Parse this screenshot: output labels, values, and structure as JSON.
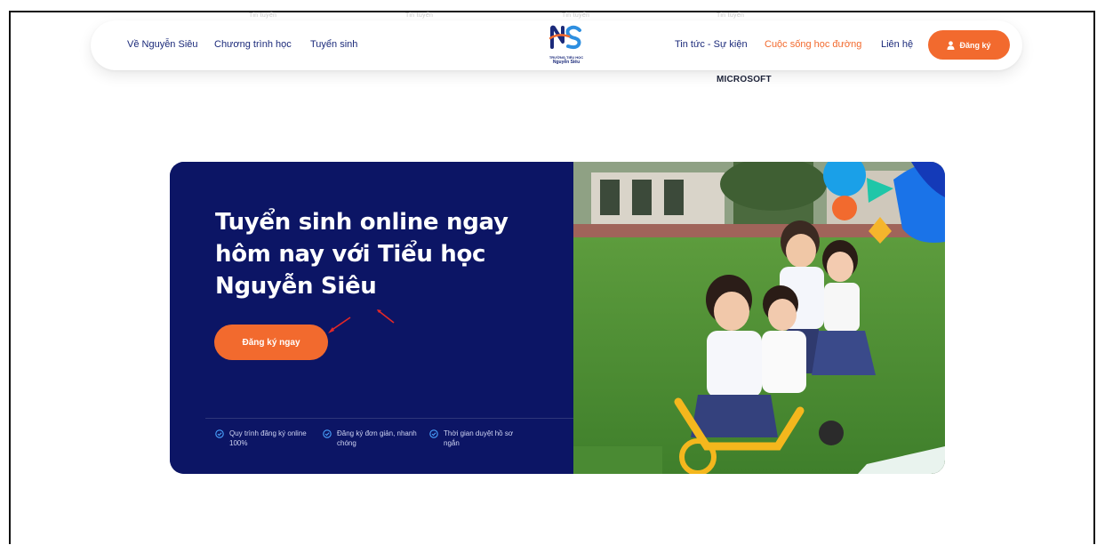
{
  "nav": {
    "faint_links": [
      "Tin tuyển",
      "Tin tuyển",
      "Tin tuyển",
      "Tin tuyển"
    ],
    "left_links": [
      "Về Nguyễn Siêu",
      "Chương trình học",
      "Tuyển sinh"
    ],
    "right_links": [
      "Tin tức - Sự kiện",
      "Cuộc sống học đường",
      "Liên hệ"
    ],
    "active_link_index": 1,
    "logo": {
      "mark": "NS",
      "line1": "TRƯỜNG TIỂU HỌC",
      "line2": "Nguyễn Siêu"
    },
    "register_button": "Đăng ký"
  },
  "microsoft_label": "MICROSOFT",
  "hero": {
    "title": "Tuyển sinh online ngay hôm nay với Tiểu học Nguyễn Siêu",
    "cta": "Đăng ký ngay",
    "features": [
      {
        "icon": "check-circle-icon",
        "text": "Quy trình đăng ký online 100%"
      },
      {
        "icon": "check-circle-icon",
        "text": "Đăng ký đơn giản, nhanh chóng"
      },
      {
        "icon": "check-circle-icon",
        "text": "Thời gian duyệt hồ sơ ngắn"
      }
    ],
    "photo": "children-playing-on-grass"
  },
  "colors": {
    "brand_navy": "#0c1565",
    "accent_orange": "#f26a2e",
    "nav_text": "#1b2a7a"
  }
}
